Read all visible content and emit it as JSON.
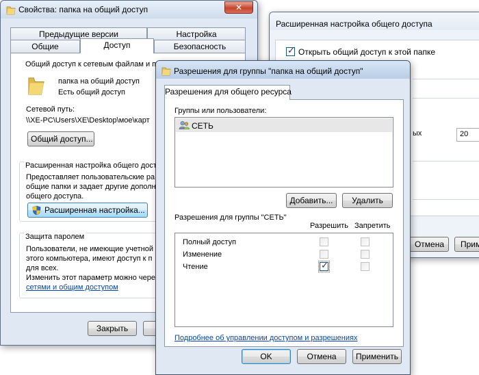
{
  "props_window": {
    "title": "Свойства: папка на общий доступ",
    "close_glyph": "✕",
    "tabs_row1": [
      "Предыдущие версии",
      "Настройка"
    ],
    "tabs_row2": [
      "Общие",
      "Доступ",
      "Безопасность"
    ],
    "share_group_title": "Общий доступ к сетевым файлам и п",
    "folder_name": "папка на общий доступ",
    "folder_status": "Есть общий доступ",
    "net_path_label": "Сетевой путь:",
    "net_path_value": "\\\\XE-PC\\Users\\XE\\Desktop\\мое\\карт",
    "share_button": "Общий доступ...",
    "adv_group_title": "Расширенная настройка общего досту",
    "adv_desc": [
      "Предоставляет пользовательские ра",
      "общие папки и задает другие дополн",
      "общего доступа."
    ],
    "adv_button": "Расширенная настройка...",
    "pwd_group_title": "Защита паролем",
    "pwd_desc": [
      "Пользователи, не имеющие учетной",
      "этого компьютера, имеют доступ к п",
      "для всех.",
      "Изменить этот параметр можно чере"
    ],
    "pwd_link": "сетями и общим доступом",
    "close_button": "Закрыть"
  },
  "adv_window": {
    "title": "Расширенная настройка общего доступа",
    "share_checkbox_label": "Открыть общий доступ к этой папке",
    "share_checked": true,
    "partial_label": "ых",
    "limit_value": "20",
    "cancel_button": "Отмена",
    "apply_button": "Приме"
  },
  "perm_window": {
    "title": "Разрешения для группы \"папка на общий доступ\"",
    "tab": "Разрешения для общего ресурса",
    "groups_label": "Группы или пользователи:",
    "users": [
      {
        "name": "СЕТЬ",
        "icon": "users-icon"
      }
    ],
    "add_button": "Добавить...",
    "remove_button": "Удалить",
    "perms_label": "Разрешения для группы \"СЕТЬ\"",
    "allow_header": "Разрешить",
    "deny_header": "Запретить",
    "permissions": [
      {
        "name": "Полный доступ",
        "allow": false,
        "deny": false
      },
      {
        "name": "Изменение",
        "allow": false,
        "deny": false
      },
      {
        "name": "Чтение",
        "allow": true,
        "deny": false
      }
    ],
    "help_link": "Подробнее об управлении доступом и разрешениях",
    "ok_button": "OK",
    "cancel_button": "Отмена",
    "apply_button": "Применить"
  }
}
